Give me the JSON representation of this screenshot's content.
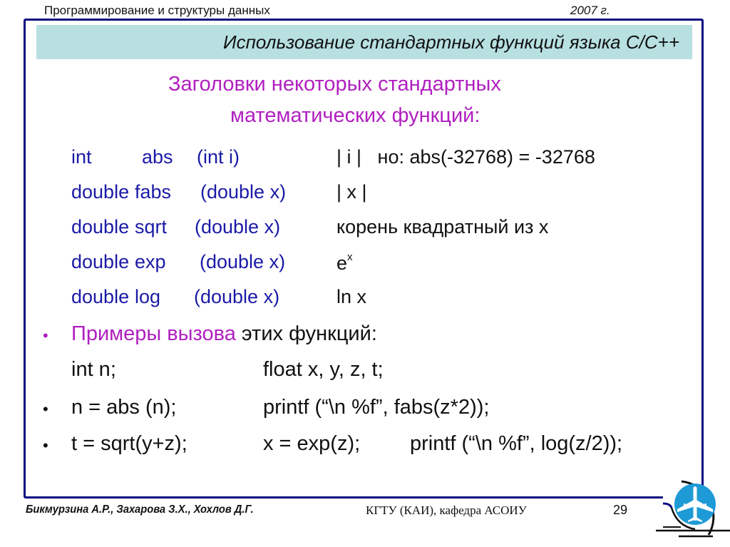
{
  "header": {
    "course": "Программирование  и структуры данных",
    "year": "2007 г."
  },
  "slide": {
    "title": "Использование стандартных функций языка С/С++",
    "subtitle_line1": "Заголовки некоторых стандартных",
    "subtitle_line2": "математических функций:",
    "functions": [
      {
        "type": "int",
        "name": "abs",
        "params": "(int i)",
        "description": "| i |   но: abs(-32768) = -32768"
      },
      {
        "type": "double",
        "name": "fabs",
        "params": "(double x)",
        "description": "| x |"
      },
      {
        "type": "double",
        "name": "sqrt",
        "params": "(double x)",
        "description": "корень квадратный из x"
      },
      {
        "type": "double",
        "name": "exp",
        "params": "(double x)",
        "description": "e",
        "description_sup": "x"
      },
      {
        "type": "double",
        "name": "log",
        "params": "(double x)",
        "description": "ln x"
      }
    ],
    "examples": {
      "heading_colored": "Примеры вызова",
      "heading_rest": " этих функций:",
      "decl_left": "int n;",
      "decl_right": "float x, y, z, t;",
      "line1_left": "n = abs (n);",
      "line1_right": "printf (“\\n %f”, fabs(z*2));",
      "line2_left": "t = sqrt(y+z);",
      "line2_mid": "x = exp(z);",
      "line2_right": "printf (“\\n %f”, log(z/2));"
    }
  },
  "footer": {
    "authors": "Бикмурзина А.Р., Захарова З.Х., Хохлов Д.Г.",
    "organization": "КГТУ  (КАИ),  кафедра АСОИУ",
    "page_number": "29"
  },
  "colors": {
    "frame": "#0a0a80",
    "title_bar": "#b8e0e1",
    "subtitle": "#b020c0",
    "code_blue": "#1a1aa6",
    "logo_blue": "#1e9ad6"
  },
  "icons": {
    "logo": "airplane-emblem-icon",
    "bullet": "bullet-dot"
  }
}
